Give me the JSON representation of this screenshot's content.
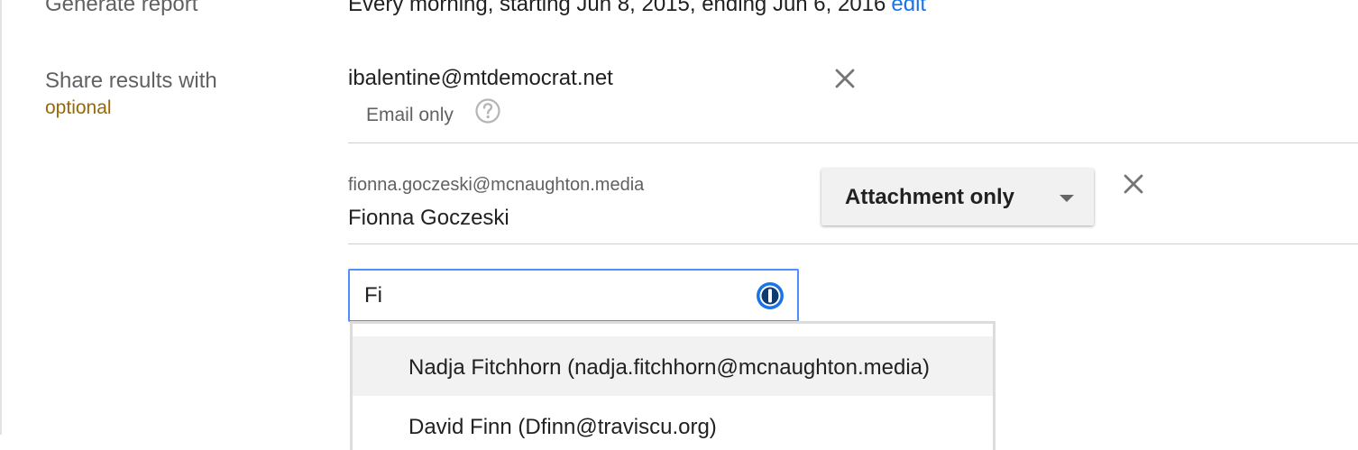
{
  "generate_report": {
    "label": "Generate report",
    "schedule": "Every morning, starting Jun 8, 2015, ending Jun 6, 2016",
    "edit_link": "edit"
  },
  "share": {
    "label": "Share results with",
    "optional_label": "optional"
  },
  "recipients": [
    {
      "email": "ibalentine@mtdemocrat.net",
      "mode": "Email only",
      "help_icon": "question-circle-icon",
      "remove_icon": "close-icon"
    },
    {
      "email": "fionna.goczeski@mcnaughton.media",
      "name": "Fionna Goczeski",
      "mode": "Attachment only",
      "remove_icon": "close-icon"
    }
  ],
  "search": {
    "value": "Fi",
    "manager_icon": "password-manager-icon"
  },
  "suggestions": [
    {
      "text": "Nadja Fitchhorn (nadja.fitchhorn@mcnaughton.media)",
      "highlighted": true
    },
    {
      "text": "David Finn (Dfinn@traviscu.org)",
      "highlighted": false
    }
  ],
  "colors": {
    "link": "#1a73e8",
    "optional": "#9a6700",
    "focus_border": "#4d90fe",
    "select_bg": "#f1f1f1",
    "highlight_bg": "#f2f2f2"
  }
}
